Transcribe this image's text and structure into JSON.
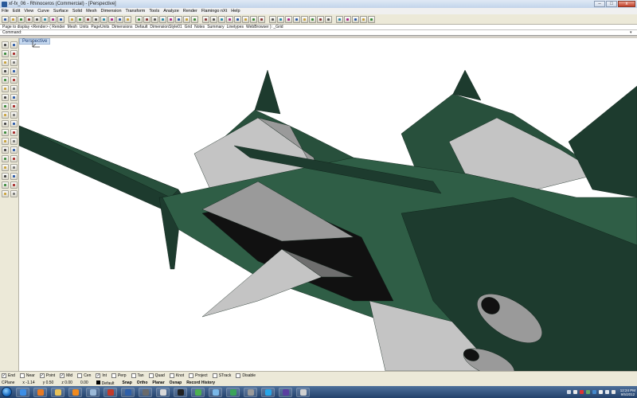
{
  "window": {
    "title": "xf-fx_06 - Rhinoceros (Commercial) - [Perspective]",
    "minimize_glyph": "–",
    "maximize_glyph": "□",
    "close_glyph": "x"
  },
  "menu": [
    "File",
    "Edit",
    "View",
    "Curve",
    "Surface",
    "Solid",
    "Mesh",
    "Dimension",
    "Transform",
    "Tools",
    "Analyze",
    "Render",
    "Flamingo nXt",
    "Help"
  ],
  "command_history": [
    "Page to display <Render> ( Render",
    "Mesh",
    "Units",
    "PageUnits",
    "Dimensions",
    "Default",
    "DimensionStyle01",
    "Grid",
    "Notes",
    "Summary",
    "Linetypes",
    "WebBrowser ): _Grid"
  ],
  "command_prompt": {
    "label": "Command:",
    "dropdown_glyph": "▾"
  },
  "viewport": {
    "label": "Perspective",
    "model_colors": {
      "green_dark": "#1d3b2e",
      "green_mid": "#28503c",
      "green_light": "#2f5e46",
      "gray_light": "#c4c4c4",
      "gray_mid": "#9a9a9a",
      "gray_dark": "#6e6e6e",
      "black": "#111111"
    }
  },
  "osnaps": [
    {
      "label": "End",
      "checked": true
    },
    {
      "label": "Near",
      "checked": false
    },
    {
      "label": "Point",
      "checked": true
    },
    {
      "label": "Mid",
      "checked": true
    },
    {
      "label": "Cen",
      "checked": false
    },
    {
      "label": "Int",
      "checked": true
    },
    {
      "label": "Perp",
      "checked": false
    },
    {
      "label": "Tan",
      "checked": false
    },
    {
      "label": "Quad",
      "checked": false
    },
    {
      "label": "Knot",
      "checked": false
    },
    {
      "label": "Project",
      "checked": false
    },
    {
      "label": "STrack",
      "checked": false
    },
    {
      "label": "Disable",
      "checked": false
    }
  ],
  "status": {
    "cplane": "CPlane",
    "x": "x -1.14",
    "y": "y 0.50",
    "z": "z 0.00",
    "z2": "0.00",
    "layer": "Default",
    "toggles": [
      "Snap",
      "Ortho",
      "Planar",
      "Osnap",
      "Record History"
    ]
  },
  "taskbar": {
    "clock_time": "12:24 PM",
    "clock_date": "9/5/2012"
  },
  "icon_names": {
    "toolbar": [
      "new-icon",
      "open-icon",
      "save-icon",
      "print-icon",
      "cut-icon",
      "copy-icon",
      "paste-icon",
      "undo-icon",
      "redo-icon",
      "pan-icon",
      "rotate-view-icon",
      "zoom-icon",
      "zoom-window-icon",
      "zoom-extents-icon",
      "zoom-selected-icon",
      "undo-view-icon",
      "four-viewports-icon",
      "grid-icon",
      "layer-icon",
      "properties-icon",
      "render-icon",
      "render-preview-icon",
      "sun-icon",
      "material-icon",
      "environment-icon",
      "camera-icon",
      "light-icon",
      "flamingo-icon",
      "ground-plane-icon",
      "decal-icon",
      "analyze-icon",
      "osnap-icon",
      "history-icon",
      "wireframe-icon",
      "shaded-icon",
      "rendered-icon",
      "ghosted-icon",
      "xray-icon",
      "mesh-icon",
      "text-icon",
      "dimension-icon",
      "hatch-icon",
      "block-icon",
      "group-icon",
      "options-icon"
    ]
  }
}
